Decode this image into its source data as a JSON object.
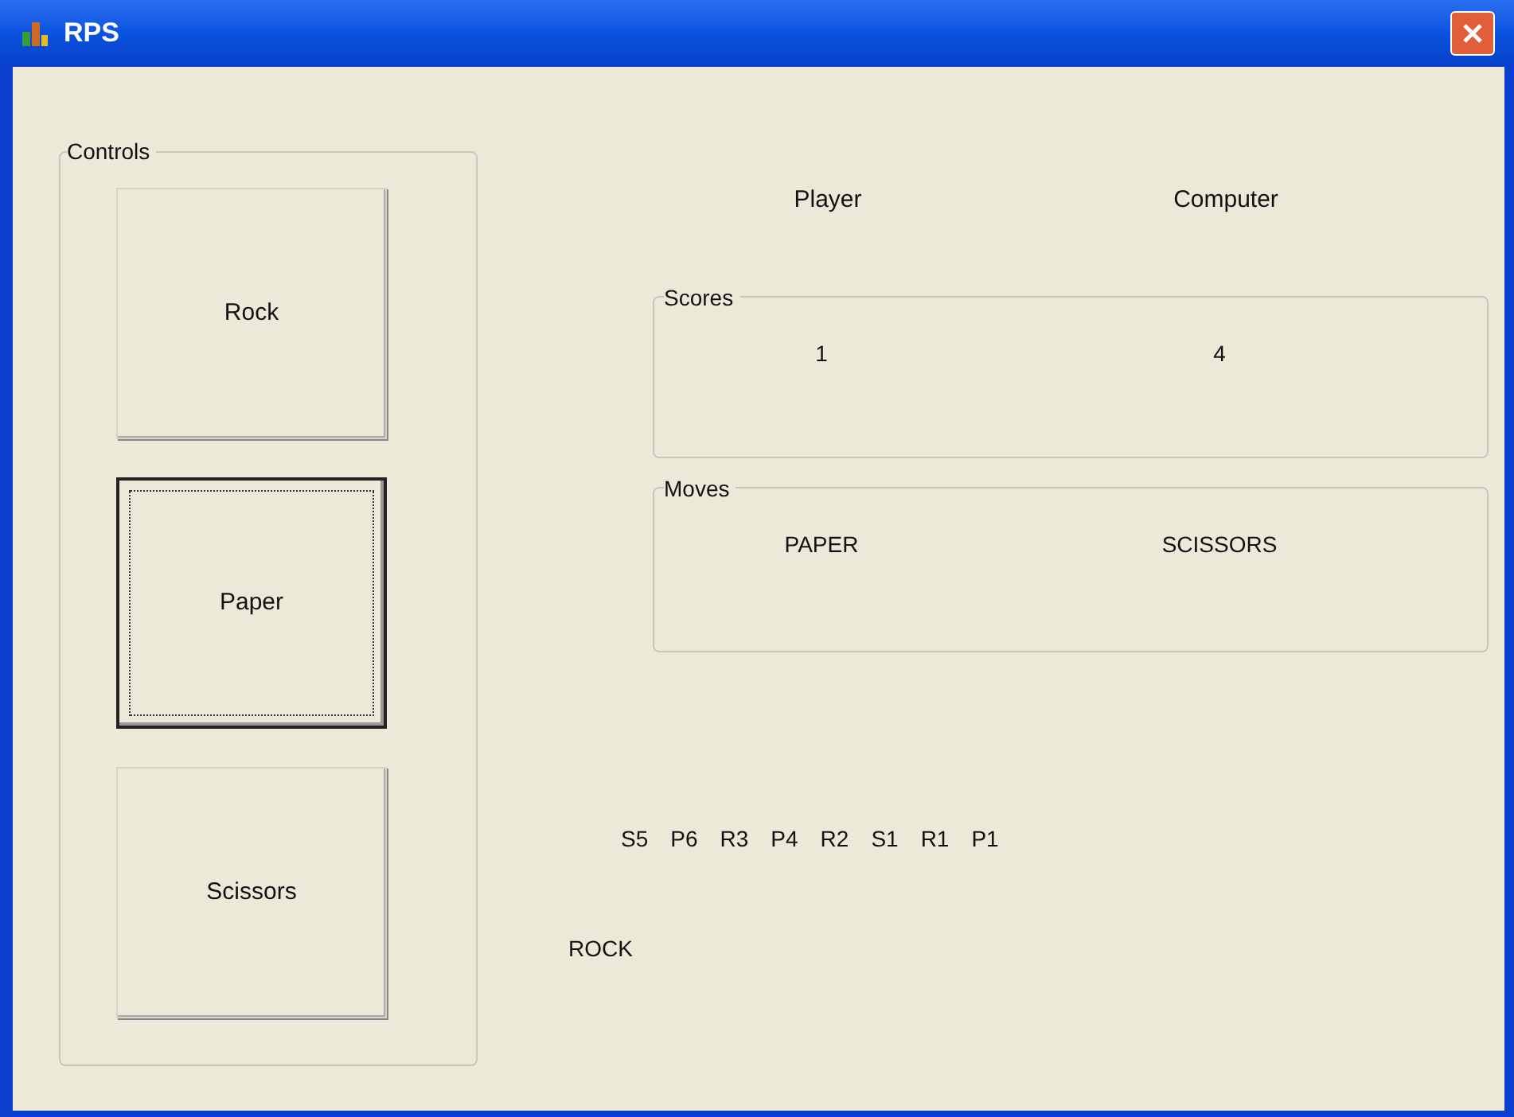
{
  "window": {
    "title": "RPS"
  },
  "controls": {
    "title": "Controls",
    "buttons": [
      {
        "label": "Rock",
        "selected": false
      },
      {
        "label": "Paper",
        "selected": true
      },
      {
        "label": "Scissors",
        "selected": false
      }
    ]
  },
  "headers": [
    "Player",
    "Computer"
  ],
  "scores": {
    "title": "Scores",
    "values": [
      "1",
      "4"
    ]
  },
  "moves": {
    "title": "Moves",
    "values": [
      "PAPER",
      "SCISSORS"
    ]
  },
  "history": [
    "S5",
    "P6",
    "R3",
    "P4",
    "R2",
    "S1",
    "R1",
    "P1"
  ],
  "last_move": "ROCK"
}
